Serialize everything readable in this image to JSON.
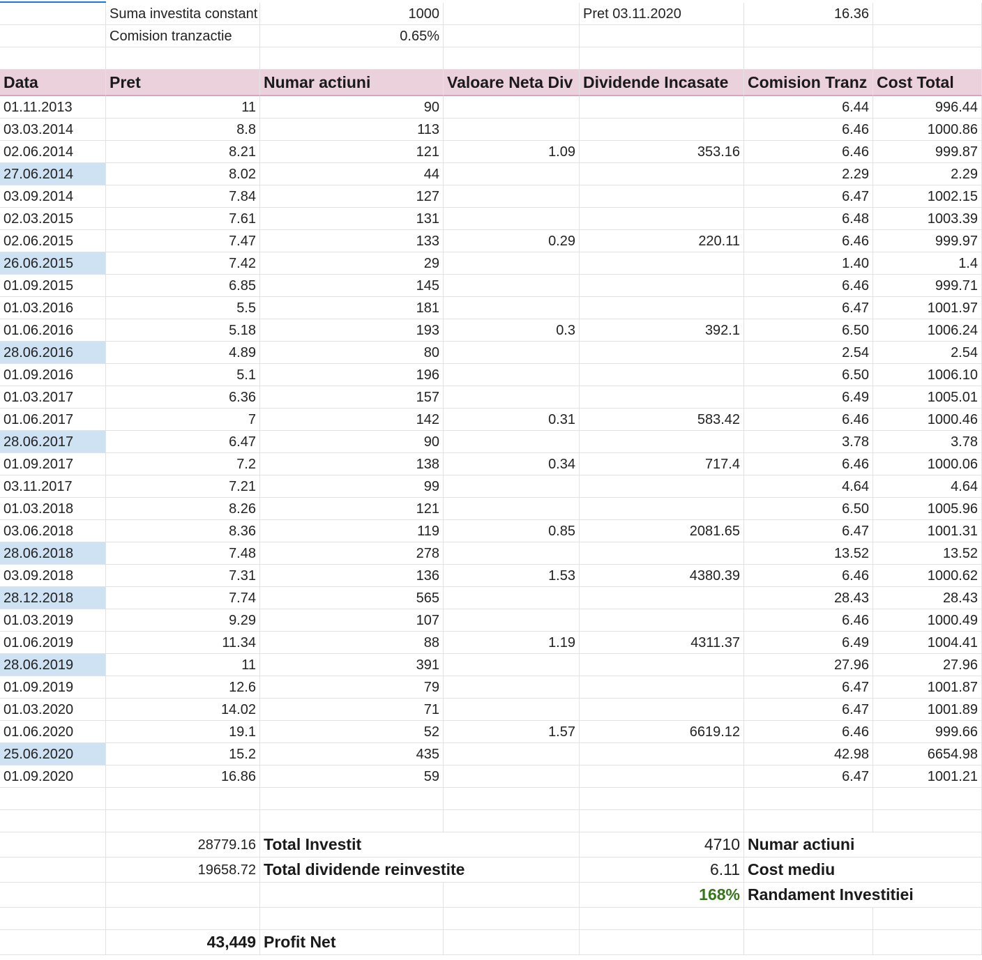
{
  "params": {
    "suma_label": "Suma investita constant",
    "suma_value": "1000",
    "pret_label": "Pret 03.11.2020",
    "pret_value": "16.36",
    "comision_label": "Comision tranzactie",
    "comision_value": "0.65%"
  },
  "table": {
    "headers": [
      "Data",
      "Pret",
      "Numar actiuni",
      "Valoare Neta Div",
      "Dividende Incasate",
      "Comision Tranz",
      "Cost Total"
    ],
    "rows": [
      {
        "date": "01.11.2013",
        "pret": "11",
        "numar": "90",
        "div": "",
        "incasate": "",
        "comision": "6.44",
        "cost": "996.44",
        "highlight": false
      },
      {
        "date": "03.03.2014",
        "pret": "8.8",
        "numar": "113",
        "div": "",
        "incasate": "",
        "comision": "6.46",
        "cost": "1000.86",
        "highlight": false
      },
      {
        "date": "02.06.2014",
        "pret": "8.21",
        "numar": "121",
        "div": "1.09",
        "incasate": "353.16",
        "comision": "6.46",
        "cost": "999.87",
        "highlight": false
      },
      {
        "date": "27.06.2014",
        "pret": "8.02",
        "numar": "44",
        "div": "",
        "incasate": "",
        "comision": "2.29",
        "cost": "2.29",
        "highlight": true
      },
      {
        "date": "03.09.2014",
        "pret": "7.84",
        "numar": "127",
        "div": "",
        "incasate": "",
        "comision": "6.47",
        "cost": "1002.15",
        "highlight": false
      },
      {
        "date": "02.03.2015",
        "pret": "7.61",
        "numar": "131",
        "div": "",
        "incasate": "",
        "comision": "6.48",
        "cost": "1003.39",
        "highlight": false
      },
      {
        "date": "02.06.2015",
        "pret": "7.47",
        "numar": "133",
        "div": "0.29",
        "incasate": "220.11",
        "comision": "6.46",
        "cost": "999.97",
        "highlight": false
      },
      {
        "date": "26.06.2015",
        "pret": "7.42",
        "numar": "29",
        "div": "",
        "incasate": "",
        "comision": "1.40",
        "cost": "1.4",
        "highlight": true
      },
      {
        "date": "01.09.2015",
        "pret": "6.85",
        "numar": "145",
        "div": "",
        "incasate": "",
        "comision": "6.46",
        "cost": "999.71",
        "highlight": false
      },
      {
        "date": "01.03.2016",
        "pret": "5.5",
        "numar": "181",
        "div": "",
        "incasate": "",
        "comision": "6.47",
        "cost": "1001.97",
        "highlight": false
      },
      {
        "date": "01.06.2016",
        "pret": "5.18",
        "numar": "193",
        "div": "0.3",
        "incasate": "392.1",
        "comision": "6.50",
        "cost": "1006.24",
        "highlight": false
      },
      {
        "date": "28.06.2016",
        "pret": "4.89",
        "numar": "80",
        "div": "",
        "incasate": "",
        "comision": "2.54",
        "cost": "2.54",
        "highlight": true
      },
      {
        "date": "01.09.2016",
        "pret": "5.1",
        "numar": "196",
        "div": "",
        "incasate": "",
        "comision": "6.50",
        "cost": "1006.10",
        "highlight": false
      },
      {
        "date": "01.03.2017",
        "pret": "6.36",
        "numar": "157",
        "div": "",
        "incasate": "",
        "comision": "6.49",
        "cost": "1005.01",
        "highlight": false
      },
      {
        "date": "01.06.2017",
        "pret": "7",
        "numar": "142",
        "div": "0.31",
        "incasate": "583.42",
        "comision": "6.46",
        "cost": "1000.46",
        "highlight": false
      },
      {
        "date": "28.06.2017",
        "pret": "6.47",
        "numar": "90",
        "div": "",
        "incasate": "",
        "comision": "3.78",
        "cost": "3.78",
        "highlight": true
      },
      {
        "date": "01.09.2017",
        "pret": "7.2",
        "numar": "138",
        "div": "0.34",
        "incasate": "717.4",
        "comision": "6.46",
        "cost": "1000.06",
        "highlight": false
      },
      {
        "date": "03.11.2017",
        "pret": "7.21",
        "numar": "99",
        "div": "",
        "incasate": "",
        "comision": "4.64",
        "cost": "4.64",
        "highlight": false
      },
      {
        "date": "01.03.2018",
        "pret": "8.26",
        "numar": "121",
        "div": "",
        "incasate": "",
        "comision": "6.50",
        "cost": "1005.96",
        "highlight": false
      },
      {
        "date": "03.06.2018",
        "pret": "8.36",
        "numar": "119",
        "div": "0.85",
        "incasate": "2081.65",
        "comision": "6.47",
        "cost": "1001.31",
        "highlight": false
      },
      {
        "date": "28.06.2018",
        "pret": "7.48",
        "numar": "278",
        "div": "",
        "incasate": "",
        "comision": "13.52",
        "cost": "13.52",
        "highlight": true
      },
      {
        "date": "03.09.2018",
        "pret": "7.31",
        "numar": "136",
        "div": "1.53",
        "incasate": "4380.39",
        "comision": "6.46",
        "cost": "1000.62",
        "highlight": false
      },
      {
        "date": "28.12.2018",
        "pret": "7.74",
        "numar": "565",
        "div": "",
        "incasate": "",
        "comision": "28.43",
        "cost": "28.43",
        "highlight": true
      },
      {
        "date": "01.03.2019",
        "pret": "9.29",
        "numar": "107",
        "div": "",
        "incasate": "",
        "comision": "6.46",
        "cost": "1000.49",
        "highlight": false
      },
      {
        "date": "01.06.2019",
        "pret": "11.34",
        "numar": "88",
        "div": "1.19",
        "incasate": "4311.37",
        "comision": "6.49",
        "cost": "1004.41",
        "highlight": false
      },
      {
        "date": "28.06.2019",
        "pret": "11",
        "numar": "391",
        "div": "",
        "incasate": "",
        "comision": "27.96",
        "cost": "27.96",
        "highlight": true
      },
      {
        "date": "01.09.2019",
        "pret": "12.6",
        "numar": "79",
        "div": "",
        "incasate": "",
        "comision": "6.47",
        "cost": "1001.87",
        "highlight": false
      },
      {
        "date": "01.03.2020",
        "pret": "14.02",
        "numar": "71",
        "div": "",
        "incasate": "",
        "comision": "6.47",
        "cost": "1001.89",
        "highlight": false
      },
      {
        "date": "01.06.2020",
        "pret": "19.1",
        "numar": "52",
        "div": "1.57",
        "incasate": "6619.12",
        "comision": "6.46",
        "cost": "999.66",
        "highlight": false
      },
      {
        "date": "25.06.2020",
        "pret": "15.2",
        "numar": "435",
        "div": "",
        "incasate": "",
        "comision": "42.98",
        "cost": "6654.98",
        "highlight": true
      },
      {
        "date": "01.09.2020",
        "pret": "16.86",
        "numar": "59",
        "div": "",
        "incasate": "",
        "comision": "6.47",
        "cost": "1001.21",
        "highlight": false
      }
    ]
  },
  "summary": {
    "total_investit_value": "28779.16",
    "total_investit_label": "Total Investit",
    "total_dividende_value": "19658.72",
    "total_dividende_label": "Total dividende reinvestite",
    "numar_actiuni_value": "4710",
    "numar_actiuni_label": "Numar actiuni",
    "cost_mediu_value": "6.11",
    "cost_mediu_label": "Cost mediu",
    "randament_value": "168%",
    "randament_label": "Randament Investitiei",
    "profit_value": "43,449",
    "profit_label": "Profit Net"
  },
  "colors": {
    "header_bg": "#ead1dc",
    "highlight_bg": "#cfe2f3",
    "positive_green": "#38761d",
    "selection_blue": "#1a73e8"
  }
}
